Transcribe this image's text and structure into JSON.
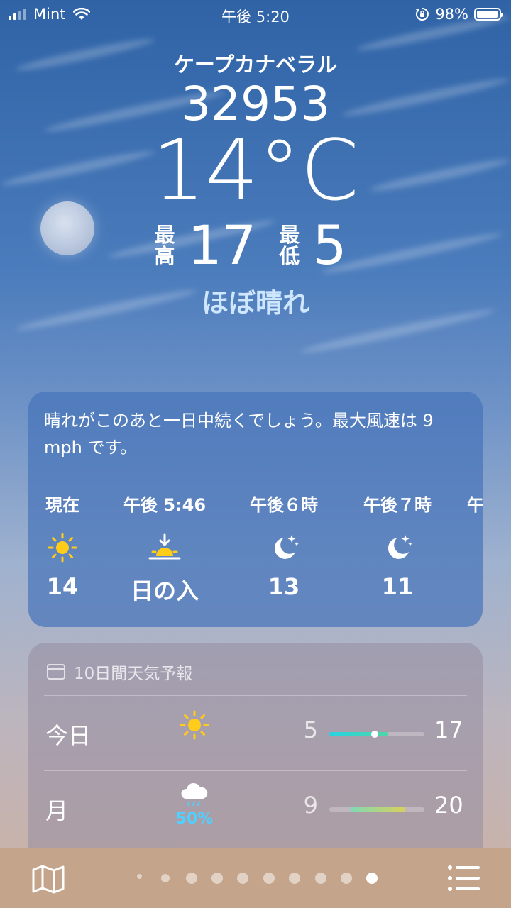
{
  "status_bar": {
    "carrier": "Mint",
    "time": "午後 5:20",
    "battery": "98%"
  },
  "location": {
    "city": "ケープカナベラル",
    "zip": "32953"
  },
  "current": {
    "temperature": "14°C",
    "high_label_top": "最",
    "high_label_bottom": "高",
    "high": "17",
    "low_label_top": "最",
    "low_label_bottom": "低",
    "low": "5",
    "condition": "ほぼ晴れ"
  },
  "hourly": {
    "summary": "晴れがこのあと一日中続くでしょう。最大風速は 9 mph です。",
    "items": [
      {
        "time": "現在",
        "icon": "sun-icon",
        "value": "14"
      },
      {
        "time": "午後 5:46",
        "icon": "sunset-icon",
        "value": "日の入"
      },
      {
        "time": "午後６時",
        "icon": "moon-stars-icon",
        "value": "13"
      },
      {
        "time": "午後７時",
        "icon": "moon-stars-icon",
        "value": "11"
      },
      {
        "time": "午",
        "icon": "",
        "value": ""
      }
    ]
  },
  "daily": {
    "header": "10日間天気予報",
    "rows": [
      {
        "day": "今日",
        "icon": "sun-icon",
        "low": "5",
        "high": "17",
        "bar_start": 0.0,
        "bar_end": 0.62,
        "current_marker": 0.48,
        "colors": [
          "#27d3e0",
          "#4fd6a8"
        ]
      },
      {
        "day": "月",
        "icon": "cloud-rain-icon",
        "precip": "50%",
        "low": "9",
        "high": "20",
        "bar_start": 0.22,
        "bar_end": 0.8,
        "colors": [
          "#7fd9b5",
          "#d8d15a"
        ]
      }
    ]
  },
  "toolbar": {
    "page_count": 9,
    "active_page": 9
  }
}
